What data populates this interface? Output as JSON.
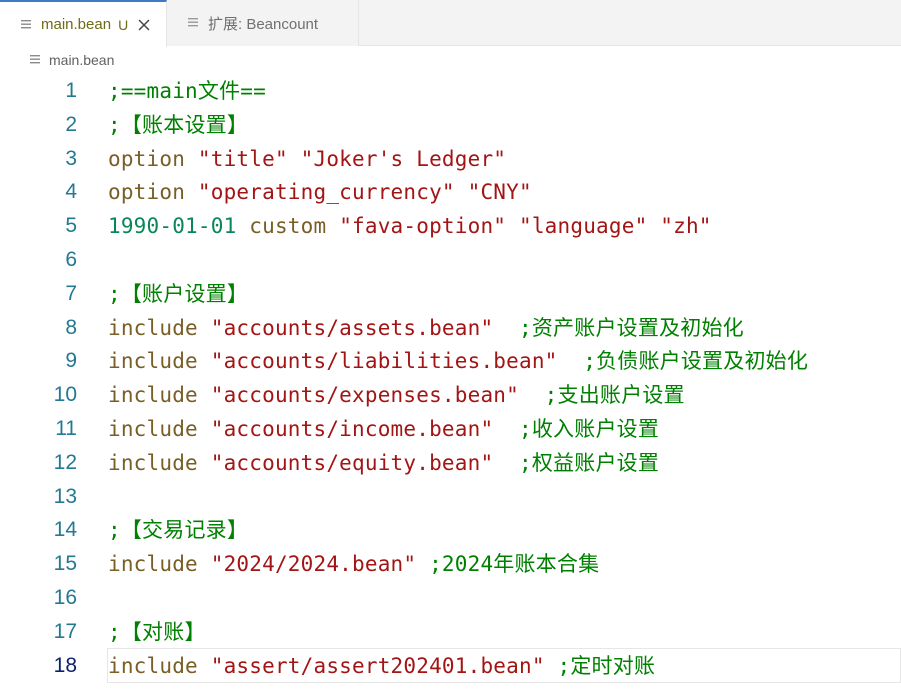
{
  "tabs": [
    {
      "label": "main.bean",
      "status": "U",
      "active": true
    },
    {
      "label": "扩展: Beancount",
      "active": false
    }
  ],
  "breadcrumb": {
    "label": "main.bean"
  },
  "editor": {
    "current_line": 18,
    "lines": [
      {
        "number": "1",
        "tokens": [
          {
            "type": "comment",
            "text": ";==main文件=="
          }
        ]
      },
      {
        "number": "2",
        "tokens": [
          {
            "type": "comment",
            "text": ";【账本设置】"
          }
        ]
      },
      {
        "number": "3",
        "tokens": [
          {
            "type": "keyword",
            "text": "option"
          },
          {
            "type": "plain",
            "text": " "
          },
          {
            "type": "string",
            "text": "\"title\""
          },
          {
            "type": "plain",
            "text": " "
          },
          {
            "type": "string",
            "text": "\"Joker's Ledger\""
          }
        ]
      },
      {
        "number": "4",
        "tokens": [
          {
            "type": "keyword",
            "text": "option"
          },
          {
            "type": "plain",
            "text": " "
          },
          {
            "type": "string",
            "text": "\"operating_currency\""
          },
          {
            "type": "plain",
            "text": " "
          },
          {
            "type": "string",
            "text": "\"CNY\""
          }
        ]
      },
      {
        "number": "5",
        "tokens": [
          {
            "type": "date",
            "text": "1990-01-01"
          },
          {
            "type": "plain",
            "text": " "
          },
          {
            "type": "keyword",
            "text": "custom"
          },
          {
            "type": "plain",
            "text": " "
          },
          {
            "type": "string",
            "text": "\"fava-option\""
          },
          {
            "type": "plain",
            "text": " "
          },
          {
            "type": "string",
            "text": "\"language\""
          },
          {
            "type": "plain",
            "text": " "
          },
          {
            "type": "string",
            "text": "\"zh\""
          }
        ]
      },
      {
        "number": "6",
        "tokens": []
      },
      {
        "number": "7",
        "tokens": [
          {
            "type": "comment",
            "text": ";【账户设置】"
          }
        ]
      },
      {
        "number": "8",
        "tokens": [
          {
            "type": "keyword",
            "text": "include"
          },
          {
            "type": "plain",
            "text": " "
          },
          {
            "type": "string",
            "text": "\"accounts/assets.bean\""
          },
          {
            "type": "plain",
            "text": "  "
          },
          {
            "type": "comment",
            "text": ";资产账户设置及初始化"
          }
        ]
      },
      {
        "number": "9",
        "tokens": [
          {
            "type": "keyword",
            "text": "include"
          },
          {
            "type": "plain",
            "text": " "
          },
          {
            "type": "string",
            "text": "\"accounts/liabilities.bean\""
          },
          {
            "type": "plain",
            "text": "  "
          },
          {
            "type": "comment",
            "text": ";负债账户设置及初始化"
          }
        ]
      },
      {
        "number": "10",
        "tokens": [
          {
            "type": "keyword",
            "text": "include"
          },
          {
            "type": "plain",
            "text": " "
          },
          {
            "type": "string",
            "text": "\"accounts/expenses.bean\""
          },
          {
            "type": "plain",
            "text": "  "
          },
          {
            "type": "comment",
            "text": ";支出账户设置"
          }
        ]
      },
      {
        "number": "11",
        "tokens": [
          {
            "type": "keyword",
            "text": "include"
          },
          {
            "type": "plain",
            "text": " "
          },
          {
            "type": "string",
            "text": "\"accounts/income.bean\""
          },
          {
            "type": "plain",
            "text": "  "
          },
          {
            "type": "comment",
            "text": ";收入账户设置"
          }
        ]
      },
      {
        "number": "12",
        "tokens": [
          {
            "type": "keyword",
            "text": "include"
          },
          {
            "type": "plain",
            "text": " "
          },
          {
            "type": "string",
            "text": "\"accounts/equity.bean\""
          },
          {
            "type": "plain",
            "text": "  "
          },
          {
            "type": "comment",
            "text": ";权益账户设置"
          }
        ]
      },
      {
        "number": "13",
        "tokens": []
      },
      {
        "number": "14",
        "tokens": [
          {
            "type": "comment",
            "text": ";【交易记录】"
          }
        ]
      },
      {
        "number": "15",
        "tokens": [
          {
            "type": "keyword",
            "text": "include"
          },
          {
            "type": "plain",
            "text": " "
          },
          {
            "type": "string",
            "text": "\"2024/2024.bean\""
          },
          {
            "type": "plain",
            "text": " "
          },
          {
            "type": "comment",
            "text": ";2024年账本合集"
          }
        ]
      },
      {
        "number": "16",
        "tokens": []
      },
      {
        "number": "17",
        "tokens": [
          {
            "type": "comment",
            "text": ";【对账】"
          }
        ]
      },
      {
        "number": "18",
        "tokens": [
          {
            "type": "keyword",
            "text": "include"
          },
          {
            "type": "plain",
            "text": " "
          },
          {
            "type": "string",
            "text": "\"assert/assert202401.bean\""
          },
          {
            "type": "plain",
            "text": " "
          },
          {
            "type": "comment",
            "text": ";定时对账"
          }
        ]
      }
    ]
  },
  "icons": {
    "file": "file-lines-icon",
    "close": "close-icon"
  },
  "colors": {
    "comment": "#008000",
    "string": "#a31515",
    "keyword": "#795e26",
    "date": "#098658",
    "line_number": "#237893",
    "current_line_number": "#0b216f",
    "tab_accent": "#3d7bc5",
    "modified_status": "#6f6b14"
  }
}
